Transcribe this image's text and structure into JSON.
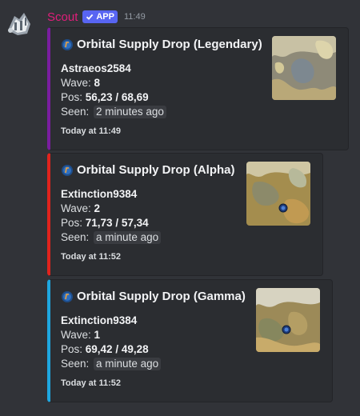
{
  "message": {
    "username": "Scout",
    "badge_label": "APP",
    "time": "11:49",
    "avatar_icon": "robot-avatar-icon",
    "accent_username": "#e01e7a",
    "badge_color": "#5865f2"
  },
  "embeds": [
    {
      "accent": "#7a1ea0",
      "title": "Orbital Supply Drop (Legendary)",
      "player": "Astraeos2584",
      "wave_label": "Wave:",
      "wave": "8",
      "pos_label": "Pos:",
      "pos": "56,23 / 68,69",
      "seen_label": "Seen:",
      "seen": "2 minutes ago",
      "footer": "Today at 11:49",
      "thumbnail_icon": "map-thumbnail"
    },
    {
      "accent": "#e0231d",
      "title": "Orbital Supply Drop (Alpha)",
      "player": "Extinction9384",
      "wave_label": "Wave:",
      "wave": "2",
      "pos_label": "Pos:",
      "pos": "71,73 / 57,34",
      "seen_label": "Seen:",
      "seen": "a minute ago",
      "footer": "Today at 11:52",
      "thumbnail_icon": "map-thumbnail"
    },
    {
      "accent": "#1ea7e0",
      "title": "Orbital Supply Drop (Gamma)",
      "player": "Extinction9384",
      "wave_label": "Wave:",
      "wave": "1",
      "pos_label": "Pos:",
      "pos": "69,42 / 49,28",
      "seen_label": "Seen:",
      "seen": "a minute ago",
      "footer": "Today at 11:52",
      "thumbnail_icon": "map-thumbnail"
    }
  ]
}
